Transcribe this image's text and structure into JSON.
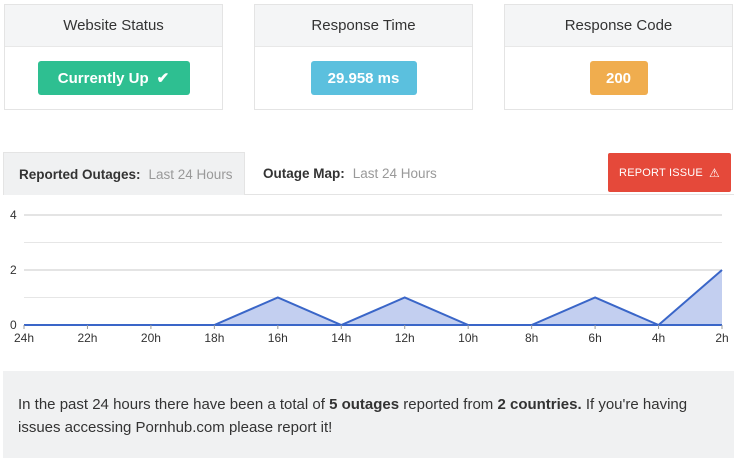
{
  "cards": {
    "status": {
      "title": "Website Status",
      "value": "Currently Up",
      "color": "#2ebf91"
    },
    "response_time": {
      "title": "Response Time",
      "value": "29.958 ms",
      "color": "#5bc0de"
    },
    "response_code": {
      "title": "Response Code",
      "value": "200",
      "color": "#f0ad4e"
    }
  },
  "tabs": {
    "outages": {
      "label": "Reported Outages:",
      "sub": "Last 24 Hours"
    },
    "map": {
      "label": "Outage Map:",
      "sub": "Last 24 Hours"
    }
  },
  "report_button": {
    "label": "REPORT ISSUE"
  },
  "chart_data": {
    "type": "area",
    "categories": [
      "24h",
      "22h",
      "20h",
      "18h",
      "16h",
      "14h",
      "12h",
      "10h",
      "8h",
      "6h",
      "4h",
      "2h"
    ],
    "values": [
      0,
      0,
      0,
      0,
      1,
      0,
      1,
      0,
      0,
      1,
      0,
      2
    ],
    "yticks": [
      "4",
      "2",
      "0"
    ],
    "ylim": [
      0,
      4
    ],
    "grid": true,
    "line_color": "#3a66c8",
    "fill_color": "#c3cff0"
  },
  "summary": {
    "p1": "In the past 24 hours there have been a total of ",
    "outages": "5 outages",
    "p2": " reported from ",
    "countries": "2 countries.",
    "p3": " If you're having issues accessing Pornhub.com please report it!"
  }
}
